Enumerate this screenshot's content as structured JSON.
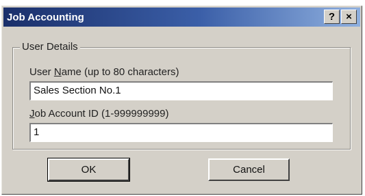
{
  "window": {
    "title": "Job Accounting",
    "help_label": "?",
    "close_label": "×"
  },
  "user_details": {
    "group_label": "User Details",
    "user_name": {
      "label_prefix": "User ",
      "label_accel": "N",
      "label_suffix": "ame (up to 80 characters)",
      "value": "Sales Section No.1"
    },
    "job_account": {
      "label_accel": "J",
      "label_suffix": "ob Account ID (1-999999999)",
      "value": "1"
    }
  },
  "buttons": {
    "ok_label": "OK",
    "cancel_label": "Cancel"
  }
}
